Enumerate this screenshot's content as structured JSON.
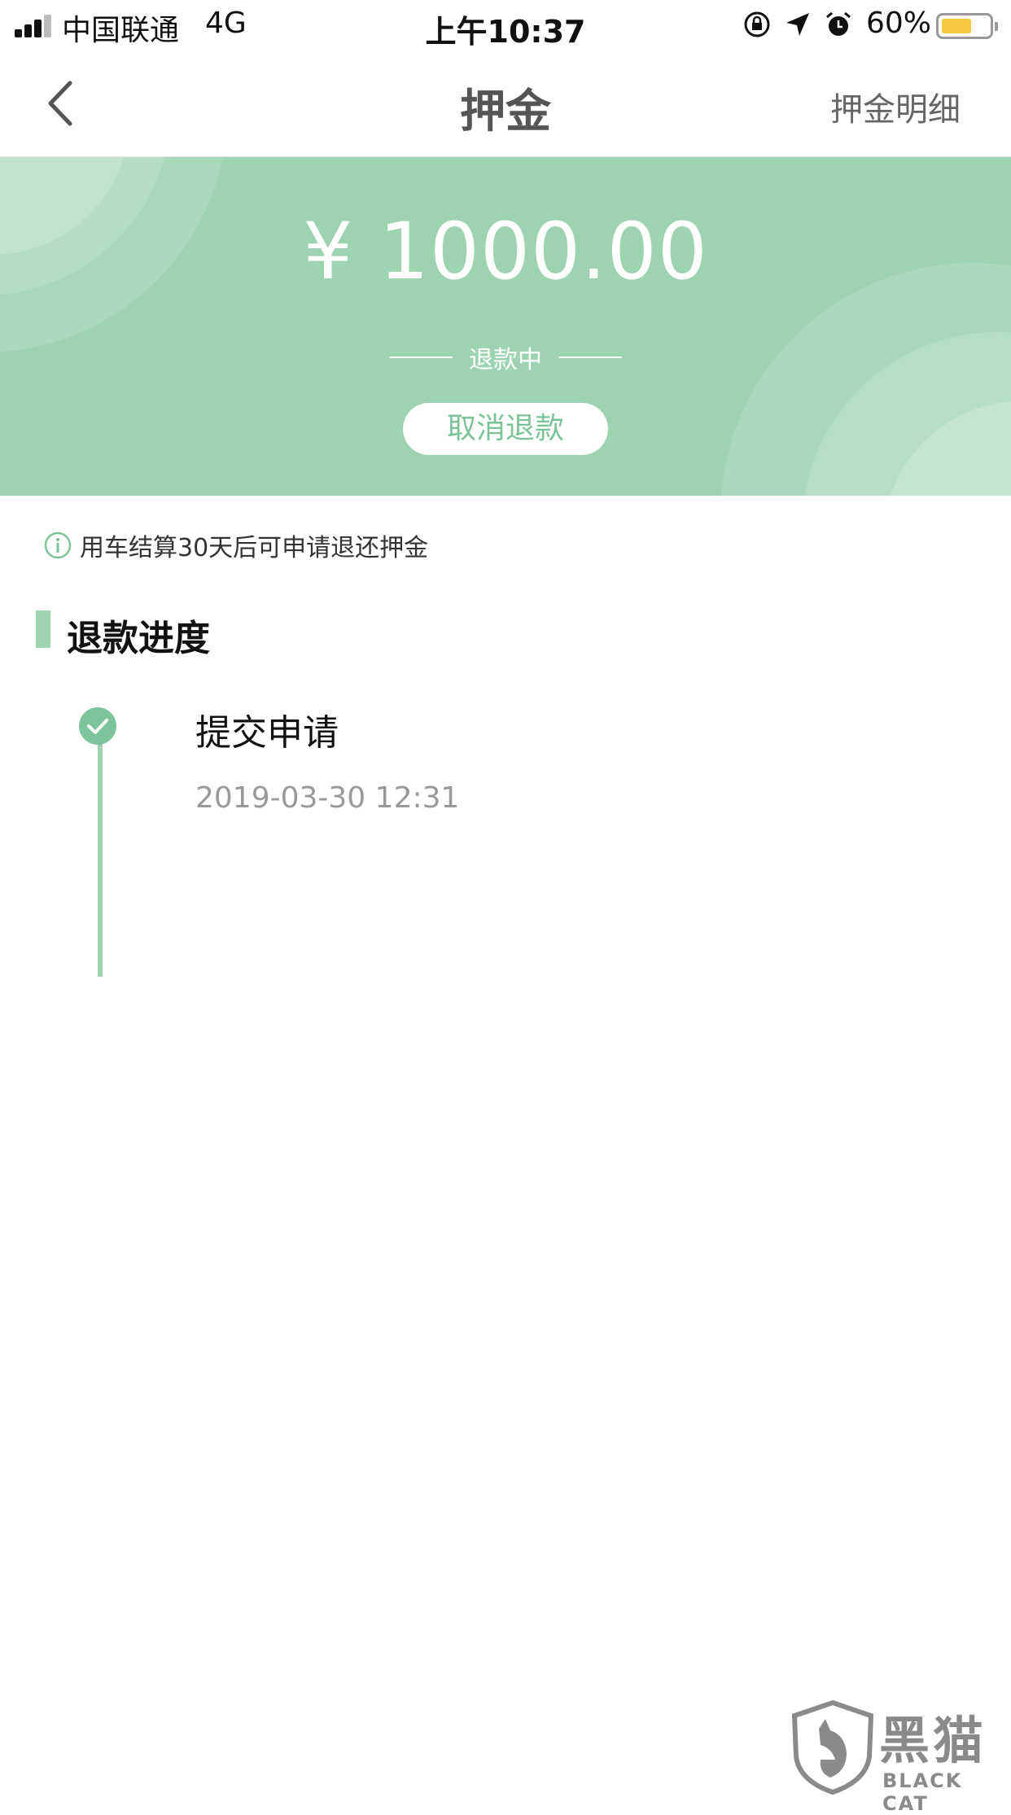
{
  "status_bar": {
    "carrier": "中国联通",
    "network": "4G",
    "time": "上午10:37",
    "battery": "60%"
  },
  "nav": {
    "title": "押金",
    "detail_link": "押金明细"
  },
  "deposit": {
    "amount": "¥ 1000.00",
    "status": "退款中",
    "cancel_button": "取消退款"
  },
  "notice": {
    "text": "用车结算30天后可申请退还押金"
  },
  "progress": {
    "title": "退款进度",
    "steps": [
      {
        "title": "提交申请",
        "time": "2019-03-30 12:31"
      }
    ]
  },
  "watermark": {
    "cn": "黑猫",
    "en": "BLACK CAT"
  },
  "colors": {
    "accent": "#9ed3b1",
    "accent_text": "#7dc399"
  }
}
